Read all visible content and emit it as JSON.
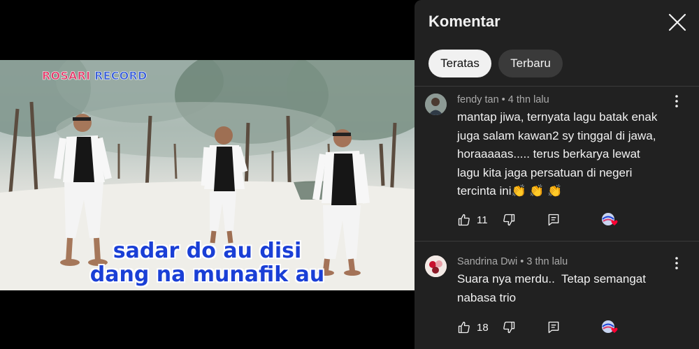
{
  "video": {
    "watermark_part1": "ROSARI",
    "watermark_part2": "RECORD",
    "lyric_line1": "sadar do au disi",
    "lyric_line2": "dang na munafik au"
  },
  "panel": {
    "title": "Komentar",
    "sort_chips": [
      {
        "label": "Teratas",
        "active": true
      },
      {
        "label": "Terbaru",
        "active": false
      }
    ]
  },
  "comments": [
    {
      "author": "fendy tan",
      "time": "4 thn lalu",
      "meta": "fendy tan • 4 thn lalu",
      "text_lines": [
        "mantap jiwa, ternyata lagu batak enak",
        "juga salam kawan2 sy tinggal di jawa,",
        "horaaaaas..... terus berkarya lewat",
        "lagu kita jaga persatuan di negeri",
        "tercinta ini👏 👏 👏"
      ],
      "likes": "11"
    },
    {
      "author": "Sandrina Dwi",
      "time": "3 thn lalu",
      "meta": "Sandrina Dwi • 3 thn lalu",
      "text_lines": [
        "Suara nya merdu..  Tetap semangat",
        "nabasa trio"
      ],
      "likes": "18"
    }
  ],
  "colors": {
    "panel_bg": "#212121",
    "chip_active_bg": "#f1f1f1",
    "chip_inactive_bg": "#3a3a3a",
    "lyric_color": "#1a3fd6"
  },
  "icons": [
    "close-icon",
    "like-icon",
    "dislike-icon",
    "reply-icon",
    "more-vert-icon",
    "creator-heart-icon"
  ]
}
